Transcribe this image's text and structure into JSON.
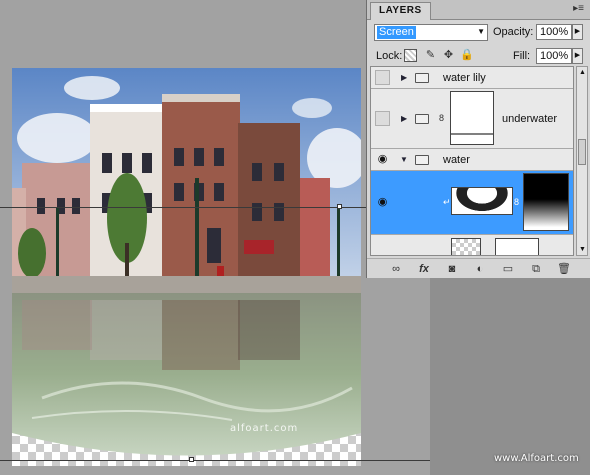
{
  "panel": {
    "tab_label": "LAYERS",
    "menu_icon": "panel-menu-icon",
    "blend_mode": "Screen",
    "opacity_label": "Opacity:",
    "opacity_value": "100%",
    "lock_label": "Lock:",
    "fill_label": "Fill:",
    "fill_value": "100%"
  },
  "layers": [
    {
      "name": "water lily",
      "type": "group",
      "visible": false,
      "expanded": false
    },
    {
      "name": "underwater",
      "type": "group",
      "visible": false,
      "expanded": false,
      "has_mask": true
    },
    {
      "name": "water",
      "type": "group",
      "visible": true,
      "expanded": true
    },
    {
      "name": "",
      "type": "layer",
      "visible": true,
      "selected": true,
      "has_mask": true
    },
    {
      "name": "",
      "type": "layer",
      "visible": true,
      "partial": true
    }
  ],
  "canvas": {
    "watermark_center": "alfoart.com",
    "watermark_corner": "www.Alfoart.com"
  },
  "icons": {
    "expand_collapsed": "▶",
    "expand_open": "▼",
    "eye": "👁",
    "link": "8"
  },
  "colors": {
    "selection": "#3d9bff",
    "panel_bg": "#d6d6d6",
    "canvas_bg": "#a2a2a2"
  }
}
